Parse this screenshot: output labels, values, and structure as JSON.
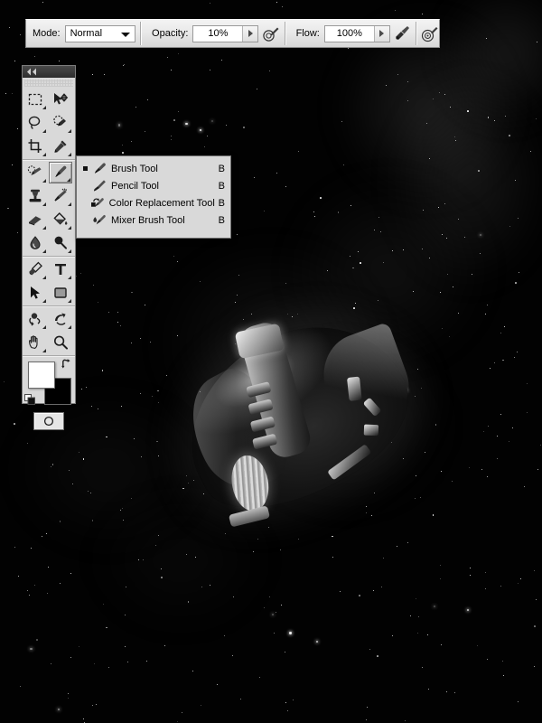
{
  "options_bar": {
    "mode_label": "Mode:",
    "mode_value": "Normal",
    "opacity_label": "Opacity:",
    "opacity_value": "10%",
    "flow_label": "Flow:",
    "flow_value": "100%",
    "airbrush_icon": "airbrush-icon",
    "tablet_pressure_opacity_icon": "tablet-pressure-opacity-icon",
    "tablet_pressure_size_icon": "tablet-pressure-size-icon"
  },
  "toolbar": {
    "collapse_icon": "double-chevron-left-icon",
    "groups": [
      {
        "tools": [
          {
            "name": "marquee-tool",
            "icon": "rectangular-marquee-icon",
            "has_flyout": true,
            "selected": false
          },
          {
            "name": "move-tool",
            "icon": "move-icon",
            "has_flyout": false,
            "selected": false
          },
          {
            "name": "lasso-tool",
            "icon": "lasso-icon",
            "has_flyout": true,
            "selected": false
          },
          {
            "name": "quick-selection-tool",
            "icon": "quick-selection-icon",
            "has_flyout": true,
            "selected": false
          },
          {
            "name": "crop-tool",
            "icon": "crop-icon",
            "has_flyout": true,
            "selected": false
          },
          {
            "name": "eyedropper-tool",
            "icon": "eyedropper-icon",
            "has_flyout": true,
            "selected": false
          }
        ]
      },
      {
        "tools": [
          {
            "name": "spot-healing-brush-tool",
            "icon": "spot-healing-brush-icon",
            "has_flyout": true,
            "selected": false
          },
          {
            "name": "brush-tool",
            "icon": "brush-icon",
            "has_flyout": true,
            "selected": true
          },
          {
            "name": "clone-stamp-tool",
            "icon": "clone-stamp-icon",
            "has_flyout": true,
            "selected": false
          },
          {
            "name": "history-brush-tool",
            "icon": "history-brush-icon",
            "has_flyout": true,
            "selected": false
          },
          {
            "name": "eraser-tool",
            "icon": "eraser-icon",
            "has_flyout": true,
            "selected": false
          },
          {
            "name": "gradient-tool",
            "icon": "paint-bucket-icon",
            "has_flyout": true,
            "selected": false
          },
          {
            "name": "blur-tool",
            "icon": "blur-drop-icon",
            "has_flyout": true,
            "selected": false
          },
          {
            "name": "dodge-tool",
            "icon": "dodge-icon",
            "has_flyout": true,
            "selected": false
          }
        ]
      },
      {
        "tools": [
          {
            "name": "pen-tool",
            "icon": "pen-icon",
            "has_flyout": true,
            "selected": false
          },
          {
            "name": "type-tool",
            "icon": "type-t-icon",
            "has_flyout": true,
            "selected": false
          },
          {
            "name": "path-selection-tool",
            "icon": "path-arrow-icon",
            "has_flyout": true,
            "selected": false
          },
          {
            "name": "rectangle-shape-tool",
            "icon": "rectangle-shape-icon",
            "has_flyout": true,
            "selected": false
          }
        ]
      },
      {
        "tools": [
          {
            "name": "3d-object-rotate-tool",
            "icon": "3d-object-rotate-icon",
            "has_flyout": true,
            "selected": false
          },
          {
            "name": "3d-camera-rotate-tool",
            "icon": "3d-camera-rotate-icon",
            "has_flyout": true,
            "selected": false
          },
          {
            "name": "hand-tool",
            "icon": "hand-icon",
            "has_flyout": true,
            "selected": false
          },
          {
            "name": "zoom-tool",
            "icon": "magnifier-icon",
            "has_flyout": false,
            "selected": false
          }
        ]
      }
    ],
    "foreground_color": "#ffffff",
    "background_color": "#000000",
    "swap_colors_icon": "swap-colors-arrow-icon",
    "default_colors_icon": "default-colors-icon",
    "quick_mask_icon": "quick-mask-icon"
  },
  "tool_flyout": {
    "items": [
      {
        "label": "Brush Tool",
        "shortcut": "B",
        "icon": "brush-icon",
        "checked": true
      },
      {
        "label": "Pencil Tool",
        "shortcut": "B",
        "icon": "pencil-icon",
        "checked": false
      },
      {
        "label": "Color Replacement Tool",
        "shortcut": "B",
        "icon": "color-replacement-icon",
        "checked": false
      },
      {
        "label": "Mixer Brush Tool",
        "shortcut": "B",
        "icon": "mixer-brush-icon",
        "checked": false
      }
    ]
  },
  "canvas": {
    "artwork_description": "computer mouse floating in a dark starfield nebula"
  }
}
